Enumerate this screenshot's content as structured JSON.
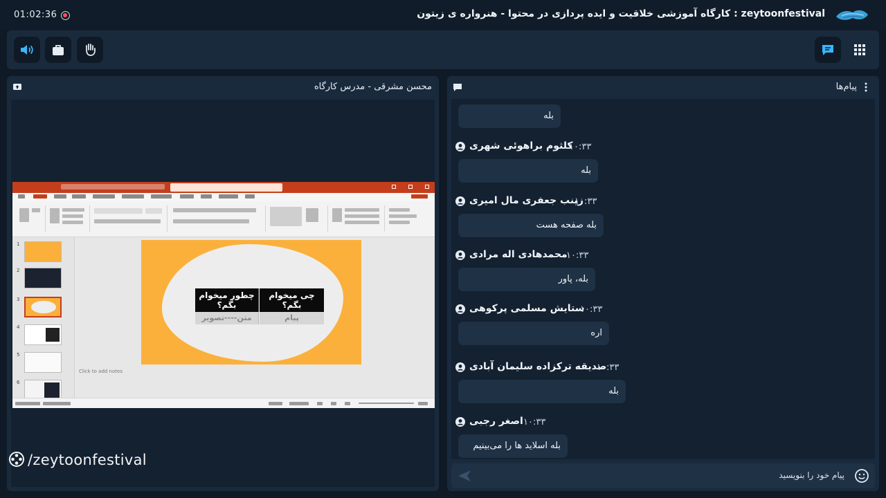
{
  "header": {
    "timer": "01:02:36",
    "title": "zeytoonfestival : کارگاه آموزشی خلاقیت و ایده پردازی در محتوا - هنرواره ی زیتون"
  },
  "toolbar": {
    "buttons": [
      "speaker-icon",
      "briefcase-icon",
      "raise-hand-icon",
      "chat-toggle-icon",
      "apps-grid-icon"
    ]
  },
  "presenter": {
    "title": "محسن مشرقی - مدرس کارگاه"
  },
  "slide": {
    "col1_head": "چی میخوام بگم؟",
    "col2_head": "چطور میخوام بگم؟",
    "col1_cell": "پیام",
    "col2_cell": "متن----تصویر",
    "notes": "Click to add notes"
  },
  "watermark": "/zeytoonfestival",
  "chat": {
    "title": "پیام‌ها",
    "messages": [
      {
        "sender": "",
        "time": "",
        "text": "بله"
      },
      {
        "sender": "کلثوم براهوئی شهری",
        "time": "۱۰:۳۳",
        "text": "بله"
      },
      {
        "sender": "زینب جعفری مال امیری",
        "time": "۱۰:۳۳",
        "text": "بله صفحه هست"
      },
      {
        "sender": "محمدهادی اله مرادی",
        "time": "۱۰:۳۳",
        "text": "بله، پاور"
      },
      {
        "sender": "ستایش مسلمی پرکوهی",
        "time": "۱۰:۳۳",
        "text": "اره"
      },
      {
        "sender": "صدیقه ترکزاده سلیمان آبادی",
        "time": "۱۰:۳۳",
        "text": "بله"
      },
      {
        "sender": "اصغر رجبی",
        "time": "۱۰:۳۳",
        "text": "بله اسلاید ها را می‌بینیم"
      }
    ],
    "input_placeholder": "پیام خود را بنویسید"
  },
  "colors": {
    "background": "#0f1a26",
    "panel": "#1a2a3d",
    "bubble": "#1f3145",
    "accent": "#38b6ff",
    "slide_orange": "#fbb03b",
    "ppt_red": "#c43e1c"
  }
}
